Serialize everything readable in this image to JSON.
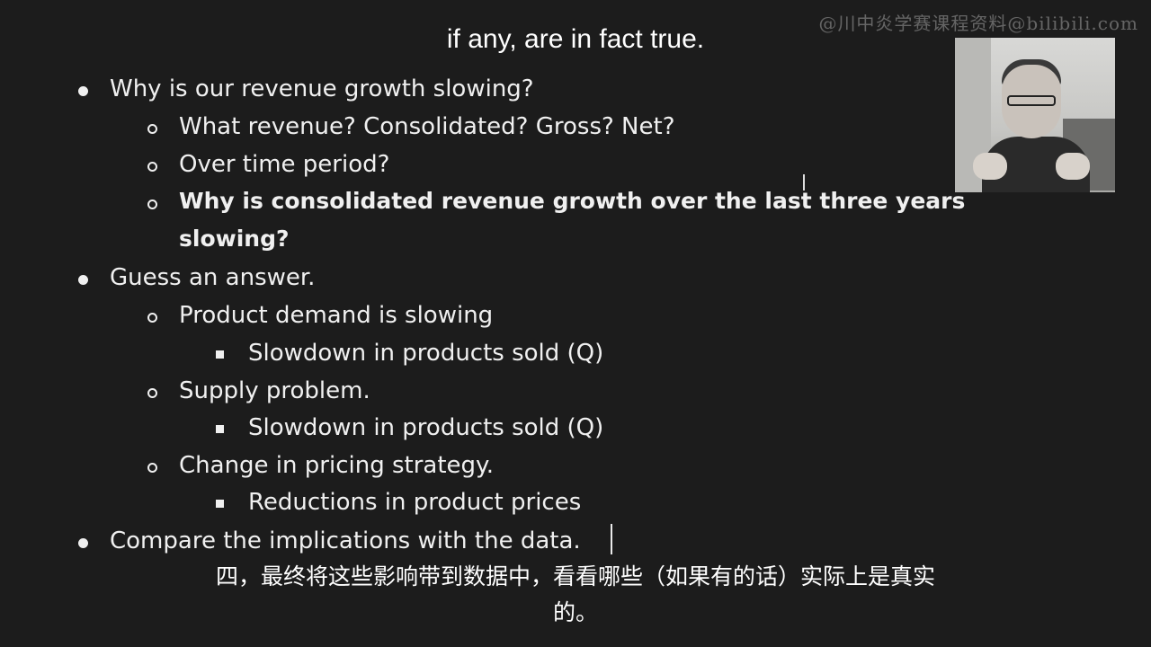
{
  "watermark": "@川中炎学赛课程资料@bilibili.com",
  "subtitle_top": "if any, are in fact true.",
  "slide": {
    "bullets": [
      "Why is our revenue growth slowing?",
      "What revenue? Consolidated? Gross? Net?",
      "Over time period?",
      "Why is consolidated revenue growth over the last three years",
      "slowing?",
      "Guess an answer.",
      "Product demand is slowing",
      "Slowdown in products sold (Q)",
      "Supply problem.",
      "Slowdown in products sold (Q)",
      "Change in pricing strategy.",
      "Reductions in product prices",
      "Compare the implications with the data."
    ]
  },
  "subtitle_cn": {
    "line1": "四，最终将这些影响带到数据中，看看哪些（如果有的话）实际上是真实",
    "line2": "的。"
  },
  "colors": {
    "background": "#1c1c1c",
    "text": "#f0f0f0"
  }
}
